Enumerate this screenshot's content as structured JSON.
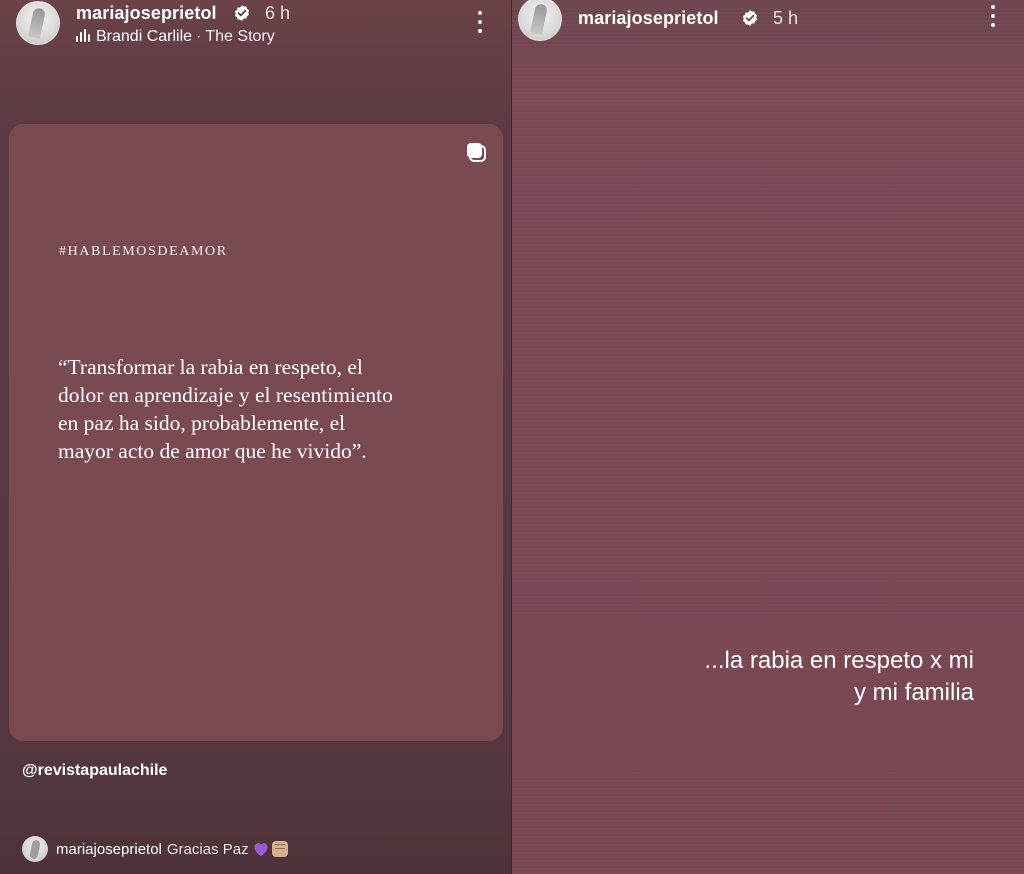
{
  "left_story": {
    "username": "mariajoseprietol",
    "time": "6 h",
    "music": {
      "artist": "Brandi Carlile",
      "separator": "·",
      "song": "The Story"
    },
    "card": {
      "hashtag": "#HABLEMOSDEAMOR",
      "quote": "“Transformar la rabia en respeto, el dolor en aprendizaje y el resentimiento en paz ha sido, probablemente, el mayor acto de amor que he vivido”."
    },
    "mention": "@revistapaulachile",
    "reply": {
      "username": "mariajoseprietol",
      "text": "Gracias Paz"
    }
  },
  "right_story": {
    "username": "mariajoseprietol",
    "time": "5 h",
    "caption_line1": "...la rabia en respeto x mi",
    "caption_line2": "y mi familia"
  },
  "colors": {
    "card_background": "#7a4a52",
    "story_background_left": "#5a3a41",
    "story_background_right": "#7a4853",
    "text": "#ffffff",
    "heart": "#9b59d6"
  },
  "icons": {
    "verified": "verified-badge-icon",
    "more": "more-vertical-icon",
    "music": "audio-bars-icon",
    "card": "sticker-copy-icon",
    "heart": "purple-heart-emoji",
    "fist": "raised-fist-emoji"
  }
}
